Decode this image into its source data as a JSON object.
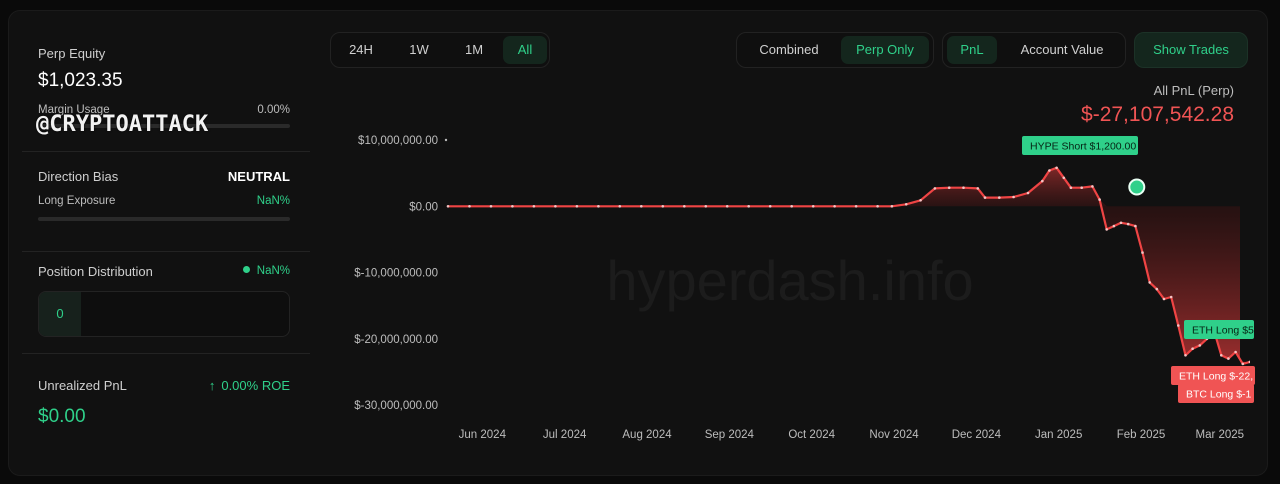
{
  "left": {
    "perp_equity_label": "Perp Equity",
    "perp_equity_value": "$1,023.35",
    "margin_usage_label": "Margin Usage",
    "margin_usage_value": "0.00%",
    "watermark": "@CRYPTOATTACK",
    "direction_bias_label": "Direction Bias",
    "direction_bias_value": "NEUTRAL",
    "long_exposure_label": "Long Exposure",
    "long_exposure_value": "NaN%",
    "position_distribution_label": "Position Distribution",
    "position_distribution_value": "NaN%",
    "position_distribution_count": "0",
    "unrealized_pnl_label": "Unrealized PnL",
    "roe_value": "0.00% ROE",
    "roe_arrow": "↑",
    "unrealized_pnl_value": "$0.00"
  },
  "toolbar": {
    "ranges": [
      "24H",
      "1W",
      "1M",
      "All"
    ],
    "active_range": "All",
    "modes": [
      "Combined",
      "Perp Only"
    ],
    "active_mode": "Perp Only",
    "metrics": [
      "PnL",
      "Account Value"
    ],
    "active_metric": "PnL",
    "show_trades_label": "Show Trades"
  },
  "chart_header": {
    "title": "All PnL (Perp)",
    "total": "$-27,107,542.28"
  },
  "chart_data": {
    "type": "area",
    "watermark": "hyperdash.info",
    "y_ticks": [
      "$10,000,000.00",
      "$0.00",
      "$-10,000,000.00",
      "$-20,000,000.00",
      "$-30,000,000.00"
    ],
    "y_tick_values": [
      10000000,
      0,
      -10000000,
      -20000000,
      -30000000
    ],
    "ylim": [
      -30000000,
      10000000
    ],
    "x_ticks": [
      "Jun 2024",
      "Jul 2024",
      "Aug 2024",
      "Sep 2024",
      "Oct 2024",
      "Nov 2024",
      "Dec 2024",
      "Jan 2025",
      "Feb 2025",
      "Mar 2025"
    ],
    "x_domain": [
      0,
      100
    ],
    "x_tick_positions": [
      2,
      13.5,
      25,
      36.5,
      48,
      59.5,
      71,
      82.5,
      94,
      105
    ],
    "series": [
      {
        "values": [
          [
            0,
            0
          ],
          [
            3,
            0
          ],
          [
            6,
            0
          ],
          [
            9,
            0
          ],
          [
            12,
            0
          ],
          [
            15,
            0
          ],
          [
            18,
            0
          ],
          [
            21,
            0
          ],
          [
            24,
            0
          ],
          [
            27,
            0
          ],
          [
            30,
            0
          ],
          [
            33,
            0
          ],
          [
            36,
            0
          ],
          [
            39,
            0
          ],
          [
            42,
            0
          ],
          [
            45,
            0
          ],
          [
            48,
            0
          ],
          [
            51,
            0
          ],
          [
            54,
            0
          ],
          [
            57,
            0
          ],
          [
            60,
            0
          ],
          [
            62,
            0
          ],
          [
            64,
            300000
          ],
          [
            66,
            900000
          ],
          [
            68,
            2700000
          ],
          [
            70,
            2800000
          ],
          [
            72,
            2800000
          ],
          [
            74,
            2700000
          ],
          [
            75,
            1300000
          ],
          [
            77,
            1300000
          ],
          [
            79,
            1400000
          ],
          [
            81,
            2000000
          ],
          [
            83,
            3800000
          ],
          [
            84,
            5400000
          ],
          [
            85,
            5800000
          ],
          [
            86,
            4300000
          ],
          [
            87,
            2800000
          ],
          [
            88.5,
            2800000
          ],
          [
            90,
            3000000
          ],
          [
            91,
            1000000
          ],
          [
            92,
            -3500000
          ],
          [
            93,
            -3000000
          ],
          [
            94,
            -2500000
          ],
          [
            95,
            -2700000
          ],
          [
            96,
            -3000000
          ],
          [
            97,
            -7000000
          ],
          [
            98,
            -11500000
          ],
          [
            99,
            -12500000
          ],
          [
            100,
            -14000000
          ],
          [
            101,
            -13700000
          ],
          [
            102,
            -18000000
          ],
          [
            103,
            -22500000
          ],
          [
            104,
            -21500000
          ],
          [
            105,
            -21000000
          ],
          [
            106,
            -20000000
          ],
          [
            107,
            -18800000
          ],
          [
            108,
            -22500000
          ],
          [
            109,
            -23000000
          ],
          [
            110,
            -22000000
          ],
          [
            111,
            -23800000
          ],
          [
            112,
            -23500000
          ],
          [
            113.5,
            -23500000
          ]
        ]
      }
    ],
    "trade_markers": [
      {
        "label": "HYPE Short $1,200.00",
        "x": 96.2,
        "y": 2900000,
        "color": "#2fd08a"
      },
      {
        "label": "ETH Long $5",
        "x": 112,
        "y": -18800000,
        "color": "#2fd08a"
      },
      {
        "label": "ETH Long $-22,",
        "x": 110,
        "y": -22500000,
        "color": "#f05454"
      },
      {
        "label": "BTC Long $-1",
        "x": 111,
        "y": -23800000,
        "color": "#f05454"
      }
    ]
  }
}
